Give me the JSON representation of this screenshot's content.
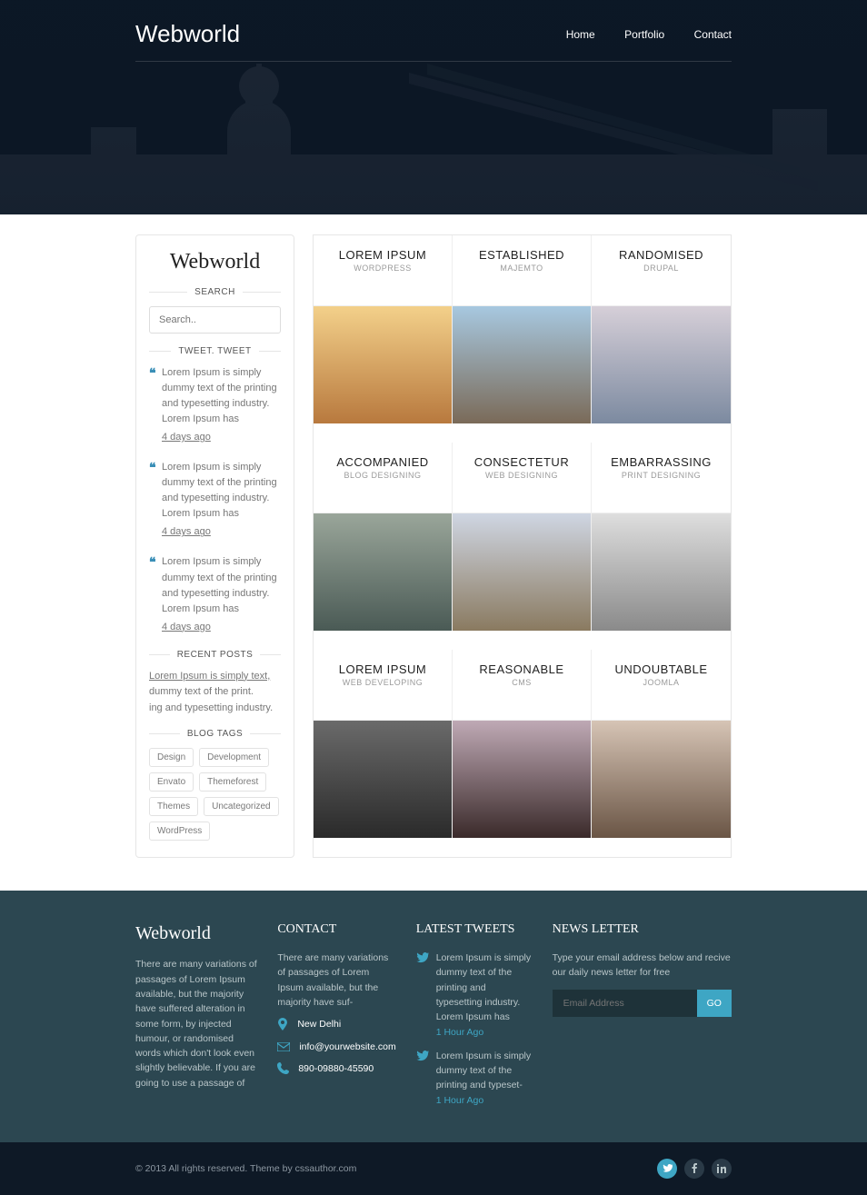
{
  "brand": "Webworld",
  "nav": {
    "home": "Home",
    "portfolio": "Portfolio",
    "contact": "Contact"
  },
  "sidebar": {
    "search_head": "SEARCH",
    "search_placeholder": "Search..",
    "tweet_head": "TWEET. TWEET",
    "tweets": [
      {
        "text": "Lorem Ipsum is simply dummy text of the printing and typesetting industry. Lorem Ipsum has",
        "ago": "4 days ago"
      },
      {
        "text": "Lorem Ipsum is simply dummy text of the printing and typesetting industry. Lorem Ipsum has",
        "ago": "4 days ago"
      },
      {
        "text": "Lorem Ipsum is simply dummy text of the printing and typesetting industry. Lorem Ipsum has",
        "ago": "4 days ago"
      }
    ],
    "recent_head": "RECENT POSTS",
    "recent_underline": "Lorem Ipsum is simply text,",
    "recent_l2": "dummy text of the print.",
    "recent_l3": "ing and typesetting industry.",
    "tags_head": "BLOG TAGS",
    "tags": [
      "Design",
      "Development",
      "Envato",
      "Themeforest",
      "Themes",
      "Uncategorized",
      "WordPress"
    ]
  },
  "portfolio": [
    {
      "title": "LOREM IPSUM",
      "sub": "WORDPRESS"
    },
    {
      "title": "ESTABLISHED",
      "sub": "MAJEMTO"
    },
    {
      "title": "RANDOMISED",
      "sub": "DRUPAL"
    },
    {
      "title": "ACCOMPANIED",
      "sub": "BLOG DESIGNING"
    },
    {
      "title": "CONSECTETUR",
      "sub": "WEB DESIGNING"
    },
    {
      "title": "EMBARRASSING",
      "sub": "PRINT DESIGNING"
    },
    {
      "title": "LOREM IPSUM",
      "sub": "WEB DEVELOPING"
    },
    {
      "title": "REASONABLE",
      "sub": "CMS"
    },
    {
      "title": "UNDOUBTABLE",
      "sub": "JOOMLA"
    }
  ],
  "footer": {
    "about": "There are many variations of passages of Lorem Ipsum available, but the majority have suffered alteration in some form, by injected humour, or randomised words which don't look even slightly believable. If you are going to use a passage of",
    "contact_head": "CONTACT",
    "contact_intro": "There are many variations of passages of Lorem Ipsum available, but the majority have suf-",
    "city": "New Delhi",
    "email": "info@yourwebsite.com",
    "phone": "890-09880-45590",
    "tweets_head": "LATEST TWEETS",
    "ftweets": [
      {
        "text": "Lorem Ipsum is simply dummy text of the printing and typesetting industry. Lorem Ipsum has",
        "ago": "1 Hour Ago"
      },
      {
        "text": "Lorem Ipsum is simply dummy text of the printing and typeset-",
        "ago": "1 Hour Ago"
      }
    ],
    "nl_head": "NEWS LETTER",
    "nl_text": "Type your email address below and recive our daily news letter for free",
    "nl_placeholder": "Email Address",
    "nl_btn": "GO"
  },
  "copyright": "© 2013 All rights reserved.  Theme by cssauthor.com"
}
